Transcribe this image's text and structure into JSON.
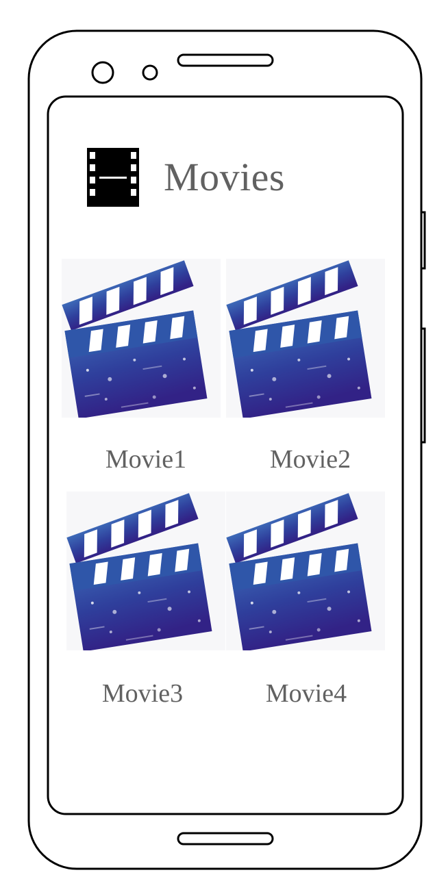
{
  "header": {
    "title": "Movies",
    "icon": "film-strip-icon"
  },
  "movies": [
    {
      "title": "Movie1",
      "poster_icon": "clapperboard-icon"
    },
    {
      "title": "Movie2",
      "poster_icon": "clapperboard-icon"
    },
    {
      "title": "Movie3",
      "poster_icon": "clapperboard-icon"
    },
    {
      "title": "Movie4",
      "poster_icon": "clapperboard-icon"
    }
  ],
  "colors": {
    "title_text": "#616161",
    "clapper_dark": "#2a2a86",
    "clapper_light": "#3d6ab8",
    "device_outline": "#000000"
  }
}
